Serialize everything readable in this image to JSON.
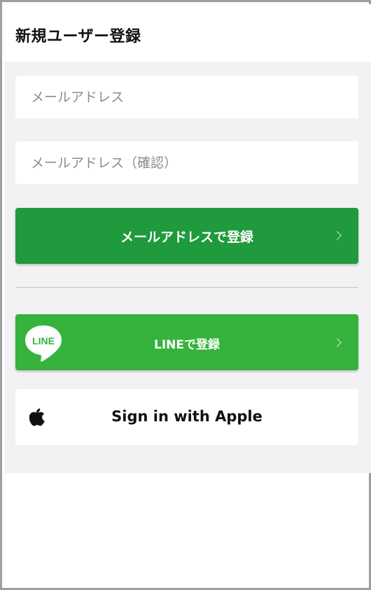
{
  "header": {
    "title": "新規ユーザー登録"
  },
  "form": {
    "email_placeholder": "メールアドレス",
    "email_confirm_placeholder": "メールアドレス（確認）"
  },
  "buttons": {
    "email_register_label": "メールアドレスで登録",
    "line_register_label": "LINEで登録",
    "line_logo_text": "LINE",
    "apple_signin_label": "Sign in with Apple"
  },
  "icons": {
    "email_chevron": "chevron-right-icon",
    "line_chevron": "chevron-right-icon",
    "line_logo": "line-logo-icon",
    "apple_logo": "apple-logo-icon"
  },
  "colors": {
    "email_button": "#1f9a3c",
    "line_button": "#36b33c",
    "background": "#f2f2f4",
    "title_text": "#111111"
  }
}
